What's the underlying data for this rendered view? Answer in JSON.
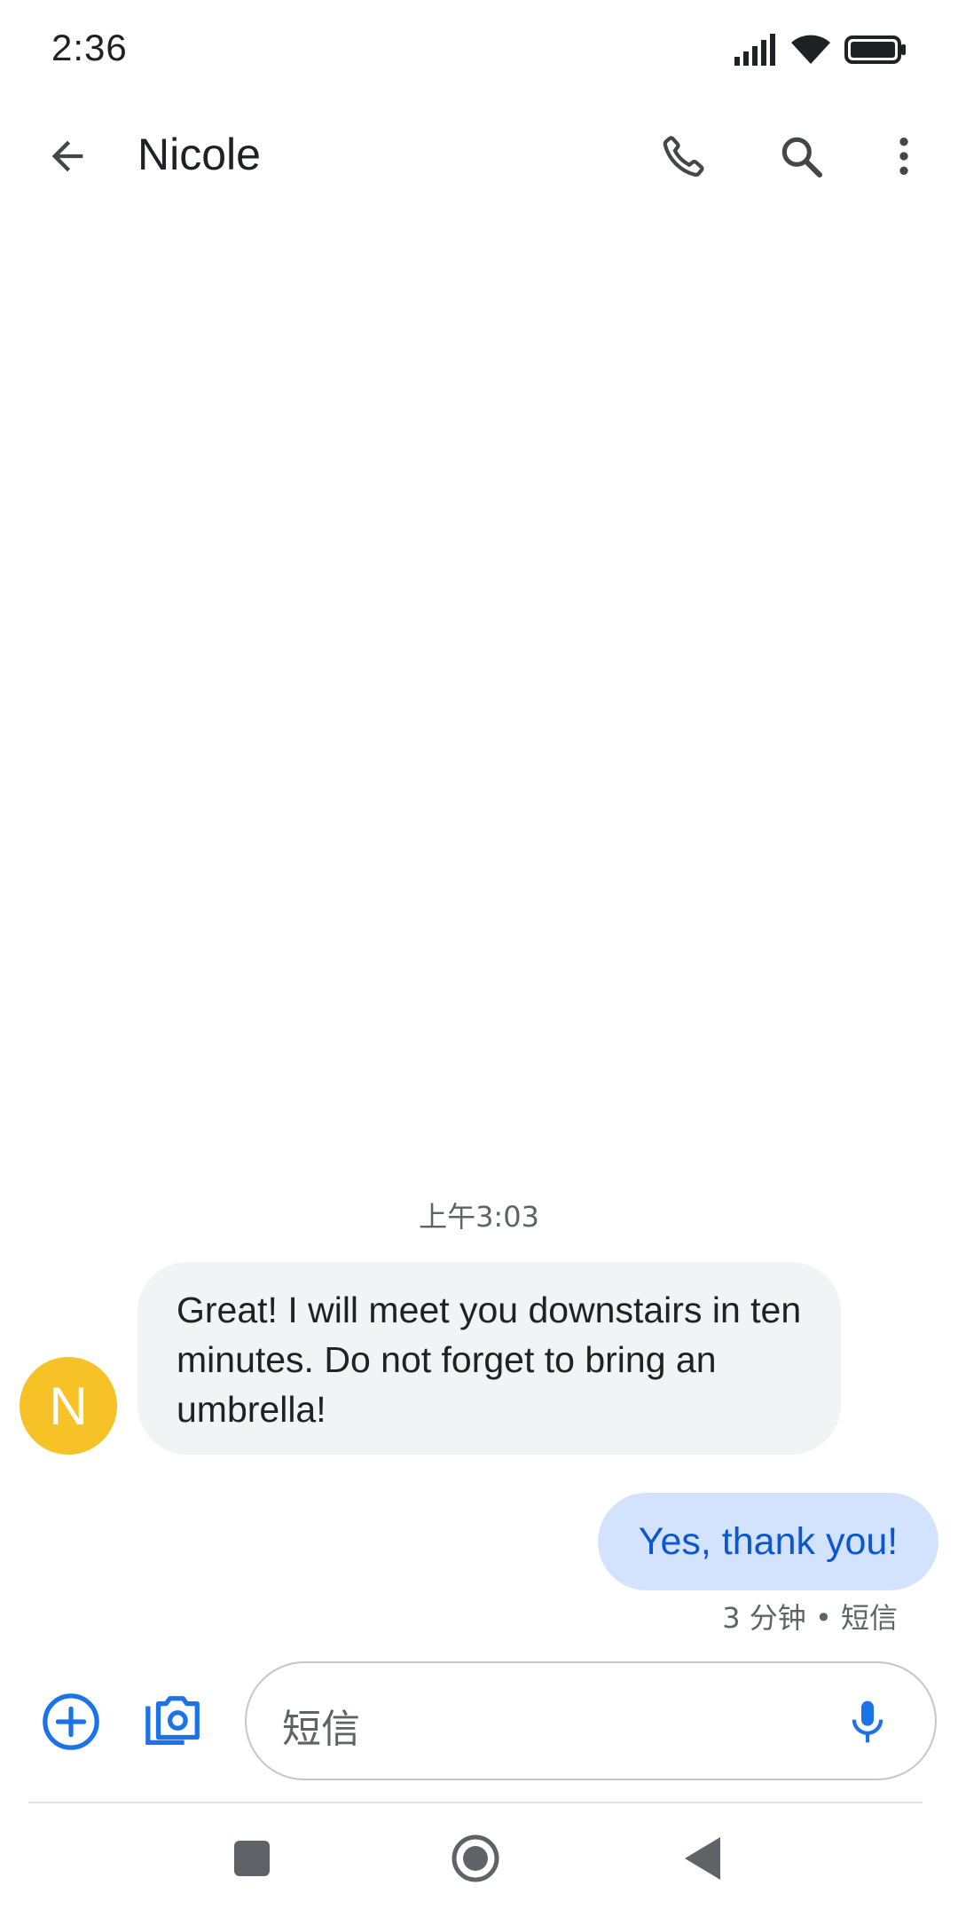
{
  "status_bar": {
    "time": "2:36",
    "icons": [
      "signal-icon",
      "wifi-icon",
      "battery-icon"
    ]
  },
  "app_bar": {
    "title": "Nicole",
    "actions": [
      "call-icon",
      "search-icon",
      "more-vert-icon"
    ]
  },
  "conversation": {
    "timestamp": "上午3:03",
    "contact_initial": "N",
    "incoming_message": "Great! I will meet you downstairs in ten minutes. Do not forget to bring an umbrella!",
    "outgoing_message": "Yes, thank you!",
    "outgoing_meta": "3 分钟 • 短信"
  },
  "compose": {
    "placeholder": "短信"
  },
  "colors": {
    "avatar": "#f6c227",
    "incoming_bubble": "#f1f3f4",
    "outgoing_bubble": "#d3e3fd",
    "outgoing_text": "#0b57d0",
    "accent": "#1a73e8"
  }
}
